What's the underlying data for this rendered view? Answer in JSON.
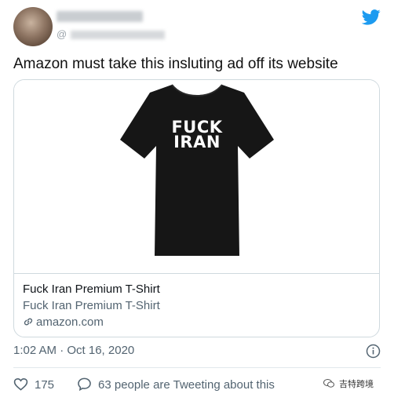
{
  "author": {
    "handle": "@"
  },
  "tweet": {
    "text": "Amazon must take this insluting ad off its website",
    "timestamp": "1:02 AM · Oct 16, 2020"
  },
  "card": {
    "shirt_text_line1": "FUCK",
    "shirt_text_line2": "IRAN",
    "title": "Fuck Iran Premium T-Shirt",
    "description": "Fuck Iran Premium T-Shirt",
    "domain": "amazon.com"
  },
  "actions": {
    "likes": "175",
    "reply_text": "63 people are Tweeting about this"
  },
  "watermark": {
    "text": "吉特跨境"
  },
  "colors": {
    "twitter_blue": "#1d9bf0",
    "secondary_text": "#536471",
    "border": "#cfd9de"
  },
  "icons": {
    "brand": "twitter-bird-icon",
    "link": "link-icon",
    "info": "info-icon",
    "like": "heart-icon",
    "reply": "speech-bubble-icon"
  }
}
